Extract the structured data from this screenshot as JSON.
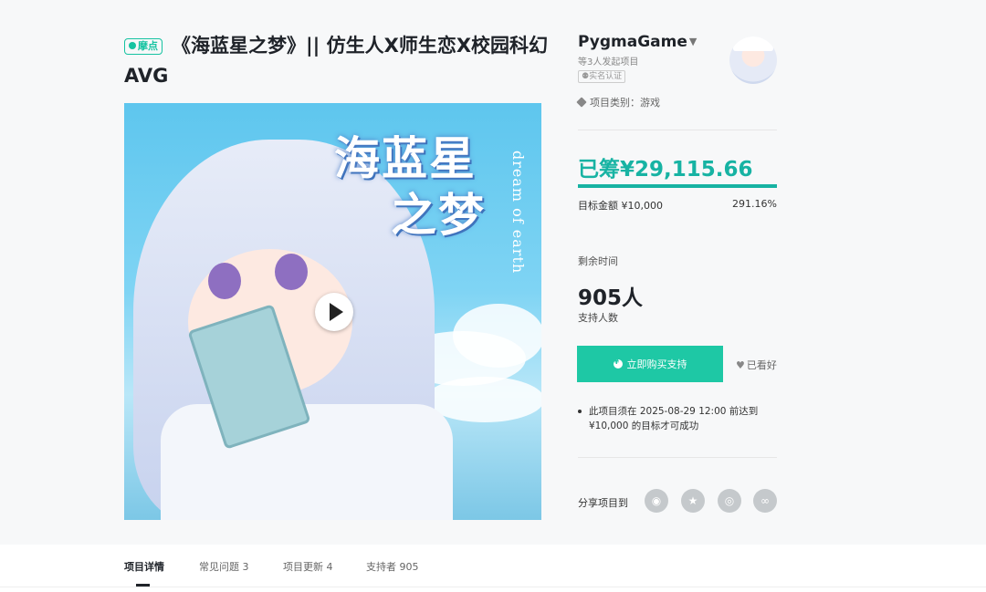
{
  "project": {
    "badge": "摩点",
    "title": "《海蓝星之梦》|| 仿生人X师生恋X校园科幻AVG"
  },
  "cover": {
    "title_line1": "海蓝星",
    "title_line2": "之梦",
    "subtitle": "dream of earth"
  },
  "creator": {
    "name": "PygmaGame",
    "sub": "等3人发起项目",
    "verified": "实名认证"
  },
  "category": "项目类别：游戏",
  "funding": {
    "raised": "已筹¥29,115.66",
    "progress_fraction": 1.0,
    "goal": "目标金额 ¥10,000",
    "percent": "291.16%"
  },
  "remaining_label": "剩余时间",
  "backers": {
    "count": "905人",
    "label": "支持人数"
  },
  "actions": {
    "buy_label": "立即购买支持",
    "like_label": "已看好"
  },
  "notice": "此项目须在 2025-08-29 12:00 前达到 ¥10,000 的目标才可成功",
  "share": {
    "label": "分享项目到",
    "icons": [
      "weibo-icon",
      "star-icon",
      "wechat-icon",
      "link-icon"
    ]
  },
  "tabs": [
    {
      "label": "项目详情"
    },
    {
      "label": "常见问题 3"
    },
    {
      "label": "项目更新 4"
    },
    {
      "label": "支持者 905"
    }
  ],
  "colors": {
    "accent": "#17b3a3",
    "button": "#1ec8a5",
    "badge": "#16c3a1"
  }
}
